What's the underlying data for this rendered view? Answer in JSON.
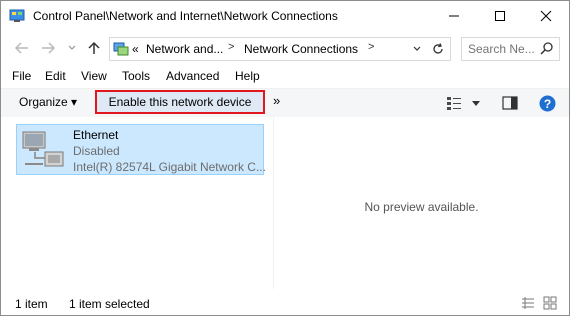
{
  "window": {
    "title": "Control Panel\\Network and Internet\\Network Connections",
    "minimize_label": "minimize",
    "maximize_label": "maximize",
    "close_label": "close"
  },
  "address": {
    "overflow": "«",
    "crumbs": [
      "Network and...",
      "Network Connections"
    ],
    "separator": ">"
  },
  "search": {
    "placeholder": "Search Ne..."
  },
  "menu": {
    "items": [
      "File",
      "Edit",
      "View",
      "Tools",
      "Advanced",
      "Help"
    ]
  },
  "toolbar": {
    "organize_label": "Organize ▾",
    "enable_label": "Enable this network device",
    "more_label": "»"
  },
  "items": [
    {
      "name": "Ethernet",
      "status": "Disabled",
      "device": "Intel(R) 82574L Gigabit Network C..."
    }
  ],
  "preview": {
    "text": "No preview available."
  },
  "status": {
    "count": "1 item",
    "selected": "1 item selected"
  },
  "colors": {
    "selection_fill": "#cce8ff",
    "selection_border": "#99d1ff",
    "highlight_border": "#e2161d",
    "help_blue": "#1e6fd1"
  }
}
